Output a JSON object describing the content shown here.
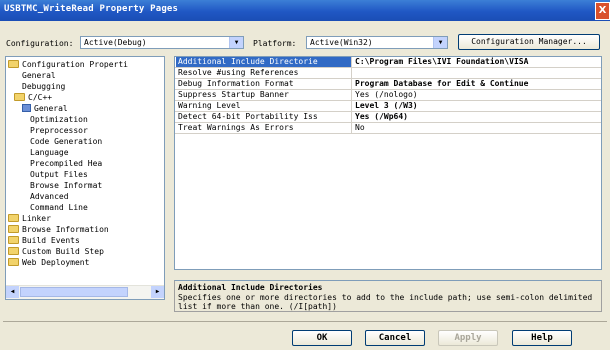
{
  "window": {
    "title": "USBTMC_WriteRead Property Pages",
    "close_label": "X"
  },
  "toolbar": {
    "configuration_label": "Configuration:",
    "configuration_value": "Active(Debug)",
    "platform_label": "Platform:",
    "platform_value": "Active(Win32)",
    "config_manager_label": "Configuration Manager..."
  },
  "tree": {
    "items": [
      {
        "label": "Configuration Properti",
        "icon": "folder-open-icon"
      },
      {
        "label": "General",
        "icon": ""
      },
      {
        "label": "Debugging",
        "icon": ""
      },
      {
        "label": "C/C++",
        "icon": "folder-open-icon"
      },
      {
        "label": "General",
        "icon": "property-page-icon"
      },
      {
        "label": "Optimization",
        "icon": ""
      },
      {
        "label": "Preprocessor",
        "icon": ""
      },
      {
        "label": "Code Generation",
        "icon": ""
      },
      {
        "label": "Language",
        "icon": ""
      },
      {
        "label": "Precompiled Hea",
        "icon": ""
      },
      {
        "label": "Output Files",
        "icon": ""
      },
      {
        "label": "Browse Informat",
        "icon": ""
      },
      {
        "label": "Advanced",
        "icon": ""
      },
      {
        "label": "Command Line",
        "icon": ""
      },
      {
        "label": "Linker",
        "icon": "folder-icon"
      },
      {
        "label": "Browse Information",
        "icon": "folder-icon"
      },
      {
        "label": "Build Events",
        "icon": "folder-icon"
      },
      {
        "label": "Custom Build Step",
        "icon": "folder-icon"
      },
      {
        "label": "Web Deployment",
        "icon": "folder-icon"
      }
    ]
  },
  "properties": [
    {
      "name": "Additional Include Directorie",
      "value": "C:\\Program Files\\IVI Foundation\\VISA"
    },
    {
      "name": "Resolve #using References",
      "value": ""
    },
    {
      "name": "Debug Information Format",
      "value": "Program Database for Edit & Continue"
    },
    {
      "name": "Suppress Startup Banner",
      "value": "Yes (/nologo)"
    },
    {
      "name": "Warning Level",
      "value": "Level 3 (/W3)"
    },
    {
      "name": "Detect 64-bit Portability Iss",
      "value": "Yes (/Wp64)"
    },
    {
      "name": "Treat Warnings As Errors",
      "value": "No"
    }
  ],
  "description": {
    "title": "Additional Include Directories",
    "text": "Specifies one or more directories to add to the include path; use semi-colon delimited list if more than one.     (/I[path])"
  },
  "buttons": {
    "ok": "OK",
    "cancel": "Cancel",
    "apply": "Apply",
    "help": "Help"
  },
  "colors": {
    "titlebar": "#2057c4",
    "selection": "#316ac5",
    "dialog_bg": "#ece9d8"
  }
}
